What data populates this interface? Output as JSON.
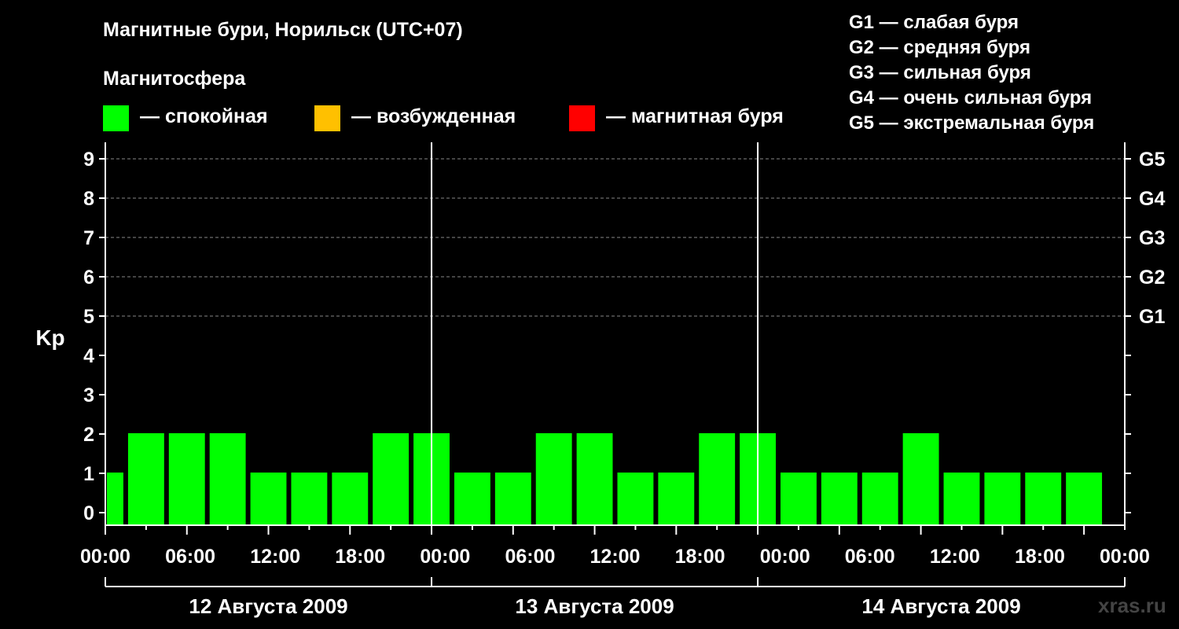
{
  "chart_data": {
    "type": "bar",
    "title": "Магнитные бури, Норильск (UTC+07)",
    "legend_title": "Магнитосфера",
    "legend": [
      {
        "label": "— спокойная",
        "color": "#00ff00"
      },
      {
        "label": "— возбужденная",
        "color": "#ffc000"
      },
      {
        "label": "— магнитная буря",
        "color": "#ff0000"
      }
    ],
    "storm_scale_legend": [
      "G1 — слабая буря",
      "G2 — средняя буря",
      "G3 — сильная буря",
      "G4 — очень сильная буря",
      "G5 — экстремальная буря"
    ],
    "ylabel": "Kp",
    "ylim": [
      0,
      9
    ],
    "y_ticks": [
      "0",
      "1",
      "2",
      "3",
      "4",
      "5",
      "6",
      "7",
      "8",
      "9"
    ],
    "right_axis_labels": [
      {
        "kp": 5,
        "label": "G1"
      },
      {
        "kp": 6,
        "label": "G2"
      },
      {
        "kp": 7,
        "label": "G3"
      },
      {
        "kp": 8,
        "label": "G4"
      },
      {
        "kp": 9,
        "label": "G5"
      }
    ],
    "x_tick_labels": [
      "00:00",
      "06:00",
      "12:00",
      "18:00",
      "00:00",
      "06:00",
      "12:00",
      "18:00",
      "00:00",
      "06:00",
      "12:00",
      "18:00",
      "00:00"
    ],
    "days": [
      "12 Августа 2009",
      "13 Августа 2009",
      "14 Августа 2009"
    ],
    "interval_hours": 3,
    "values": [
      1,
      2,
      2,
      2,
      1,
      1,
      1,
      2,
      2,
      1,
      1,
      2,
      2,
      1,
      1,
      2,
      2,
      1,
      1,
      1,
      2,
      1,
      1,
      1,
      1
    ],
    "bar_color": "#00ff00",
    "grid": "dashed at 5–9"
  },
  "watermark": "xras.ru"
}
